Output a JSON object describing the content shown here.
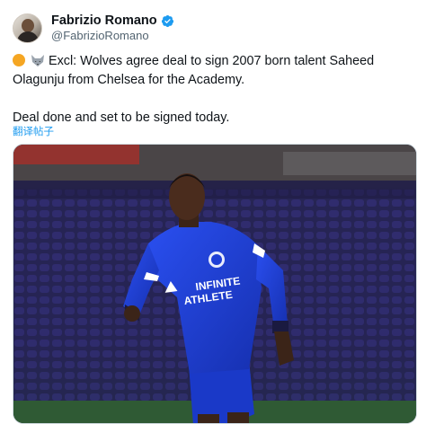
{
  "tweet": {
    "author": {
      "display_name": "Fabrizio Romano",
      "handle": "@FabrizioRomano",
      "verified": true,
      "avatar_icon": "profile-photo"
    },
    "text_line1": "Excl: Wolves agree deal to sign 2007 born talent Saheed Olagunju from Chelsea for the Academy.",
    "text_line2": "Deal done and set to be signed today.",
    "emojis": [
      "orange-circle-emoji",
      "wolf-emoji"
    ],
    "translate_label": "翻译帖子"
  },
  "media": {
    "description_icon": "player-photo",
    "shirt_sponsor_line1": "INFINITE",
    "shirt_sponsor_line2": "ATHLETE",
    "colors": {
      "kit": "#1f3fd6",
      "stands": "#2b2760",
      "pitch": "#254a2c"
    }
  },
  "colors": {
    "link": "#1d9bf0",
    "verified": "#1d9bf0",
    "text": "#0f1419",
    "secondary": "#536471"
  }
}
